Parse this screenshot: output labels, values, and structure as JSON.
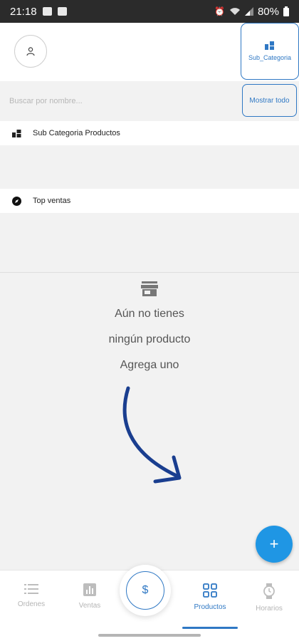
{
  "status_bar": {
    "time": "21:18",
    "battery": "80%",
    "icons": [
      "gallery-icon",
      "notification-icon",
      "alarm-icon",
      "wifi-icon",
      "signal-icon",
      "battery-icon"
    ]
  },
  "header": {
    "avatar_icon": "user-icon",
    "subcategory_button": {
      "label": "Sub_Categoria",
      "icon": "category-icon"
    }
  },
  "search": {
    "placeholder": "Buscar por nombre...",
    "value": "",
    "show_all_label": "Mostrar todo"
  },
  "sections": {
    "subcategory_products": {
      "label": "Sub Categoria Productos",
      "icon": "category-icon"
    },
    "top_sales": {
      "label": "Top ventas",
      "icon": "compass-icon"
    }
  },
  "empty_state": {
    "icon": "store-icon",
    "line1": "Aún no tienes",
    "line2": "ningún producto",
    "line3": "Agrega uno"
  },
  "fab": {
    "label": "+"
  },
  "bottom_nav": {
    "items": [
      {
        "label": "Ordenes",
        "icon": "list-icon",
        "active": false
      },
      {
        "label": "Ventas",
        "icon": "bar-chart-icon",
        "active": false
      },
      {
        "label": "Productos",
        "icon": "grid-icon",
        "active": true
      },
      {
        "label": "Horarios",
        "icon": "watch-icon",
        "active": false
      }
    ],
    "center_button": {
      "label": "$",
      "icon": "dollar-icon"
    }
  },
  "colors": {
    "accent": "#2f78c4",
    "fab": "#1f96e4",
    "arrow": "#1a3e8f",
    "background": "#f2f2f2",
    "status_bar": "#2b2b2b"
  }
}
